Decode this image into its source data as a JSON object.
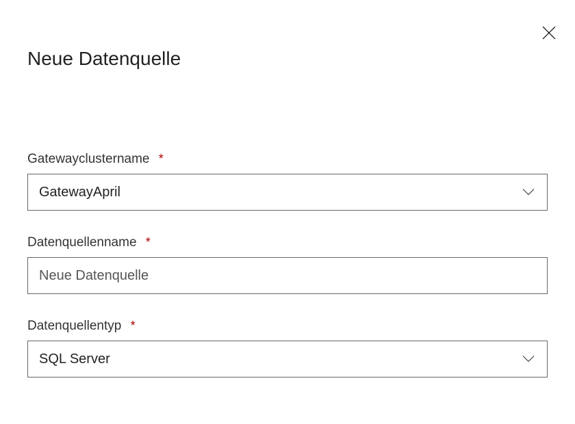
{
  "header": {
    "title": "Neue Datenquelle"
  },
  "fields": {
    "gatewayCluster": {
      "label": "Gatewayclustername",
      "required": true,
      "value": "GatewayApril"
    },
    "dataSourceName": {
      "label": "Datenquellenname",
      "required": true,
      "value": "Neue Datenquelle"
    },
    "dataSourceType": {
      "label": "Datenquellentyp",
      "required": true,
      "value": "SQL Server"
    }
  },
  "requiredMarker": "*"
}
